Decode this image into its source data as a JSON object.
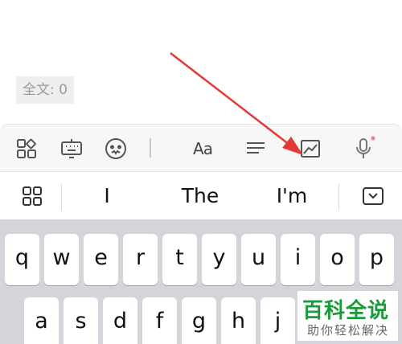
{
  "editor": {
    "word_count": "全文: 0"
  },
  "toolbar": {
    "items": [
      "apps-icon",
      "keyboard-icon",
      "emoji-icon",
      "text-format-icon",
      "align-icon",
      "image-icon",
      "microphone-icon"
    ],
    "text_format_label": "Aa"
  },
  "suggestions": {
    "items": [
      "I",
      "The",
      "I'm"
    ]
  },
  "keyboard": {
    "row1": [
      "q",
      "w",
      "e",
      "r",
      "t",
      "y",
      "u",
      "i",
      "o",
      "p"
    ],
    "row2": [
      "a",
      "s",
      "d",
      "f",
      "g",
      "h",
      "j"
    ]
  },
  "watermark": {
    "title": "百科全说",
    "subtitle": "助你轻松解决"
  },
  "colors": {
    "arrow": "#e53935",
    "watermark": "#1b9a3b",
    "keyboard_bg": "#d3d5db",
    "mic_dot": "#f08080"
  }
}
